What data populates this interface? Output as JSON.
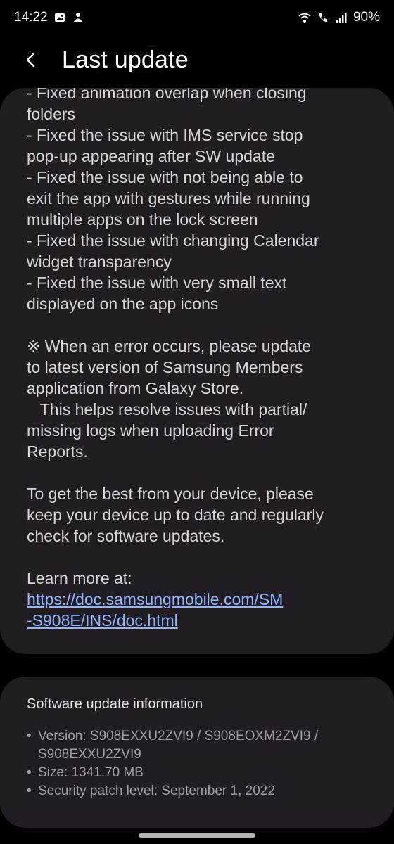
{
  "status_bar": {
    "time": "14:22",
    "battery": "90%",
    "left_icons": [
      "gallery-icon",
      "notification-icon"
    ],
    "right_icons": [
      "wifi-icon",
      "wifi-calling-icon",
      "signal-icon"
    ]
  },
  "app_bar": {
    "title": "Last update"
  },
  "notes": {
    "paragraphs": [
      [
        " - Fixed animation overlap when closing",
        "folders",
        " - Fixed the issue with IMS service stop",
        "pop-up appearing after SW update",
        " - Fixed the issue with not being able to",
        "exit the app with gestures while running",
        "multiple apps on the lock screen",
        " - Fixed the issue with changing Calendar",
        "widget transparency",
        " - Fixed the issue with very small text",
        "displayed on the app icons"
      ],
      [
        "※ When an error occurs, please update",
        "to latest version of Samsung Members",
        "application from Galaxy Store.",
        "   This helps resolve issues with partial/",
        "missing logs when uploading Error",
        "Reports."
      ],
      [
        "To get the best from your device, please",
        "keep your device up to date and regularly",
        "check for software updates."
      ]
    ],
    "learn_more_label": "Learn more at:",
    "link_line1": "https://doc.samsungmobile.com/SM",
    "link_line2": "-S908E/INS/doc.html"
  },
  "info": {
    "title": "Software update information",
    "bullet": "•",
    "version_line1": "Version: S908EXXU2ZVI9 / S908EOXM2ZVI9 /",
    "version_line2": "S908EXXU2ZVI9",
    "size": "Size: 1341.70 MB",
    "security_patch": "Security patch level: September 1, 2022"
  },
  "colors": {
    "background": "#000000",
    "card": "#221c23",
    "link": "#8fb6ff"
  }
}
